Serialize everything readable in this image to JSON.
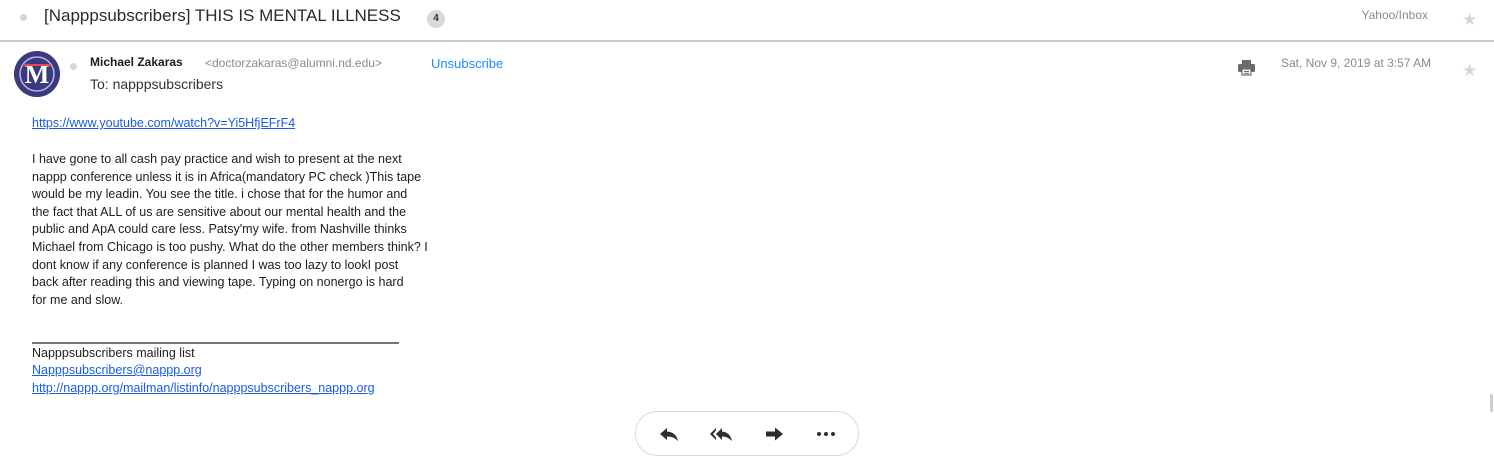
{
  "subject": {
    "title": "[Napppsubscribers] THIS IS MENTAL ILLNESS",
    "count": "4",
    "folder": "Yahoo/Inbox"
  },
  "message": {
    "sender_name": "Michael Zakaras",
    "sender_email": "<doctorzakaras@alumni.nd.edu>",
    "unsubscribe_label": "Unsubscribe",
    "to_line": "To: napppsubscribers",
    "date": "Sat, Nov 9, 2019 at 3:57 AM",
    "avatar_letter": "M"
  },
  "body": {
    "link": "https://www.youtube.com/watch?v=Yi5HfjEFrF4",
    "lines": [
      "I have gone to  all cash pay practice and wish to present at the next",
      "nappp conference unless it is in  Africa(mandatory PC check )This tape",
      "would be my leadin. You see the title. i chose that for the humor and",
      "the fact that ALL of us are sensitive about our mental health and the",
      "public and ApA could care less. Patsy'my wife. from Nashville thinks",
      "Michael from Chicago is too pushy. What do the other members think? I",
      "dont know if any conference is planned I was too lazy to lookI post",
      "back after reading this and viewing tape. Typing on nonergo is hard",
      "for me and slow."
    ],
    "footer": {
      "list_name": "Napppsubscribers mailing list",
      "list_email": "Napppsubscribers@nappp.org",
      "list_url": "http://nappp.org/mailman/listinfo/napppsubscribers_nappp.org"
    }
  },
  "actions": {
    "reply_icon": "reply-icon",
    "reply_all_icon": "reply-all-icon",
    "forward_icon": "forward-icon",
    "more_icon": "more-icon"
  },
  "colors": {
    "link": "#1a5ce0",
    "unsubscribe": "#188fff",
    "avatar_bg": "#3c3a7e",
    "muted_text": "#8a8a8a"
  }
}
